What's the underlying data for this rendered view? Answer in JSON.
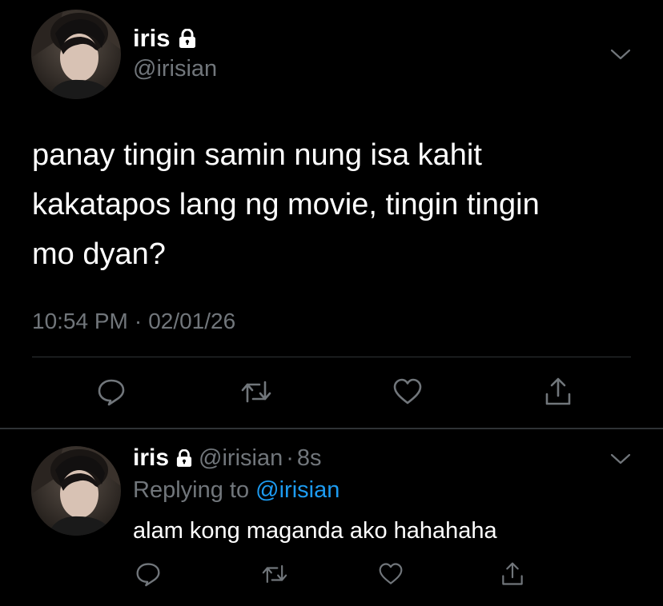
{
  "main_tweet": {
    "display_name": "iris",
    "handle": "@irisian",
    "text": "panay tingin samin nung isa kahit\nkakatapos lang ng movie, tingin tingin\nmo dyan?",
    "time": "10:54 PM",
    "separator": "·",
    "date": "02/01/26"
  },
  "reply_tweet": {
    "display_name": "iris",
    "handle": "@irisian",
    "separator": "·",
    "age": "8s",
    "replying_prefix": "Replying to",
    "replying_handle": "@irisian",
    "text": "alam kong maganda ako hahahaha"
  },
  "icons": {
    "lock": "lock-icon",
    "menu": "chevron-down-icon",
    "reply": "comment-bubble-icon",
    "retweet": "retweet-icon",
    "like": "heart-icon",
    "share": "share-upload-icon"
  },
  "colors": {
    "background": "#000000",
    "text_primary": "#ffffff",
    "text_secondary": "#71767b",
    "link": "#1d9bf0",
    "divider": "#2f3336"
  }
}
